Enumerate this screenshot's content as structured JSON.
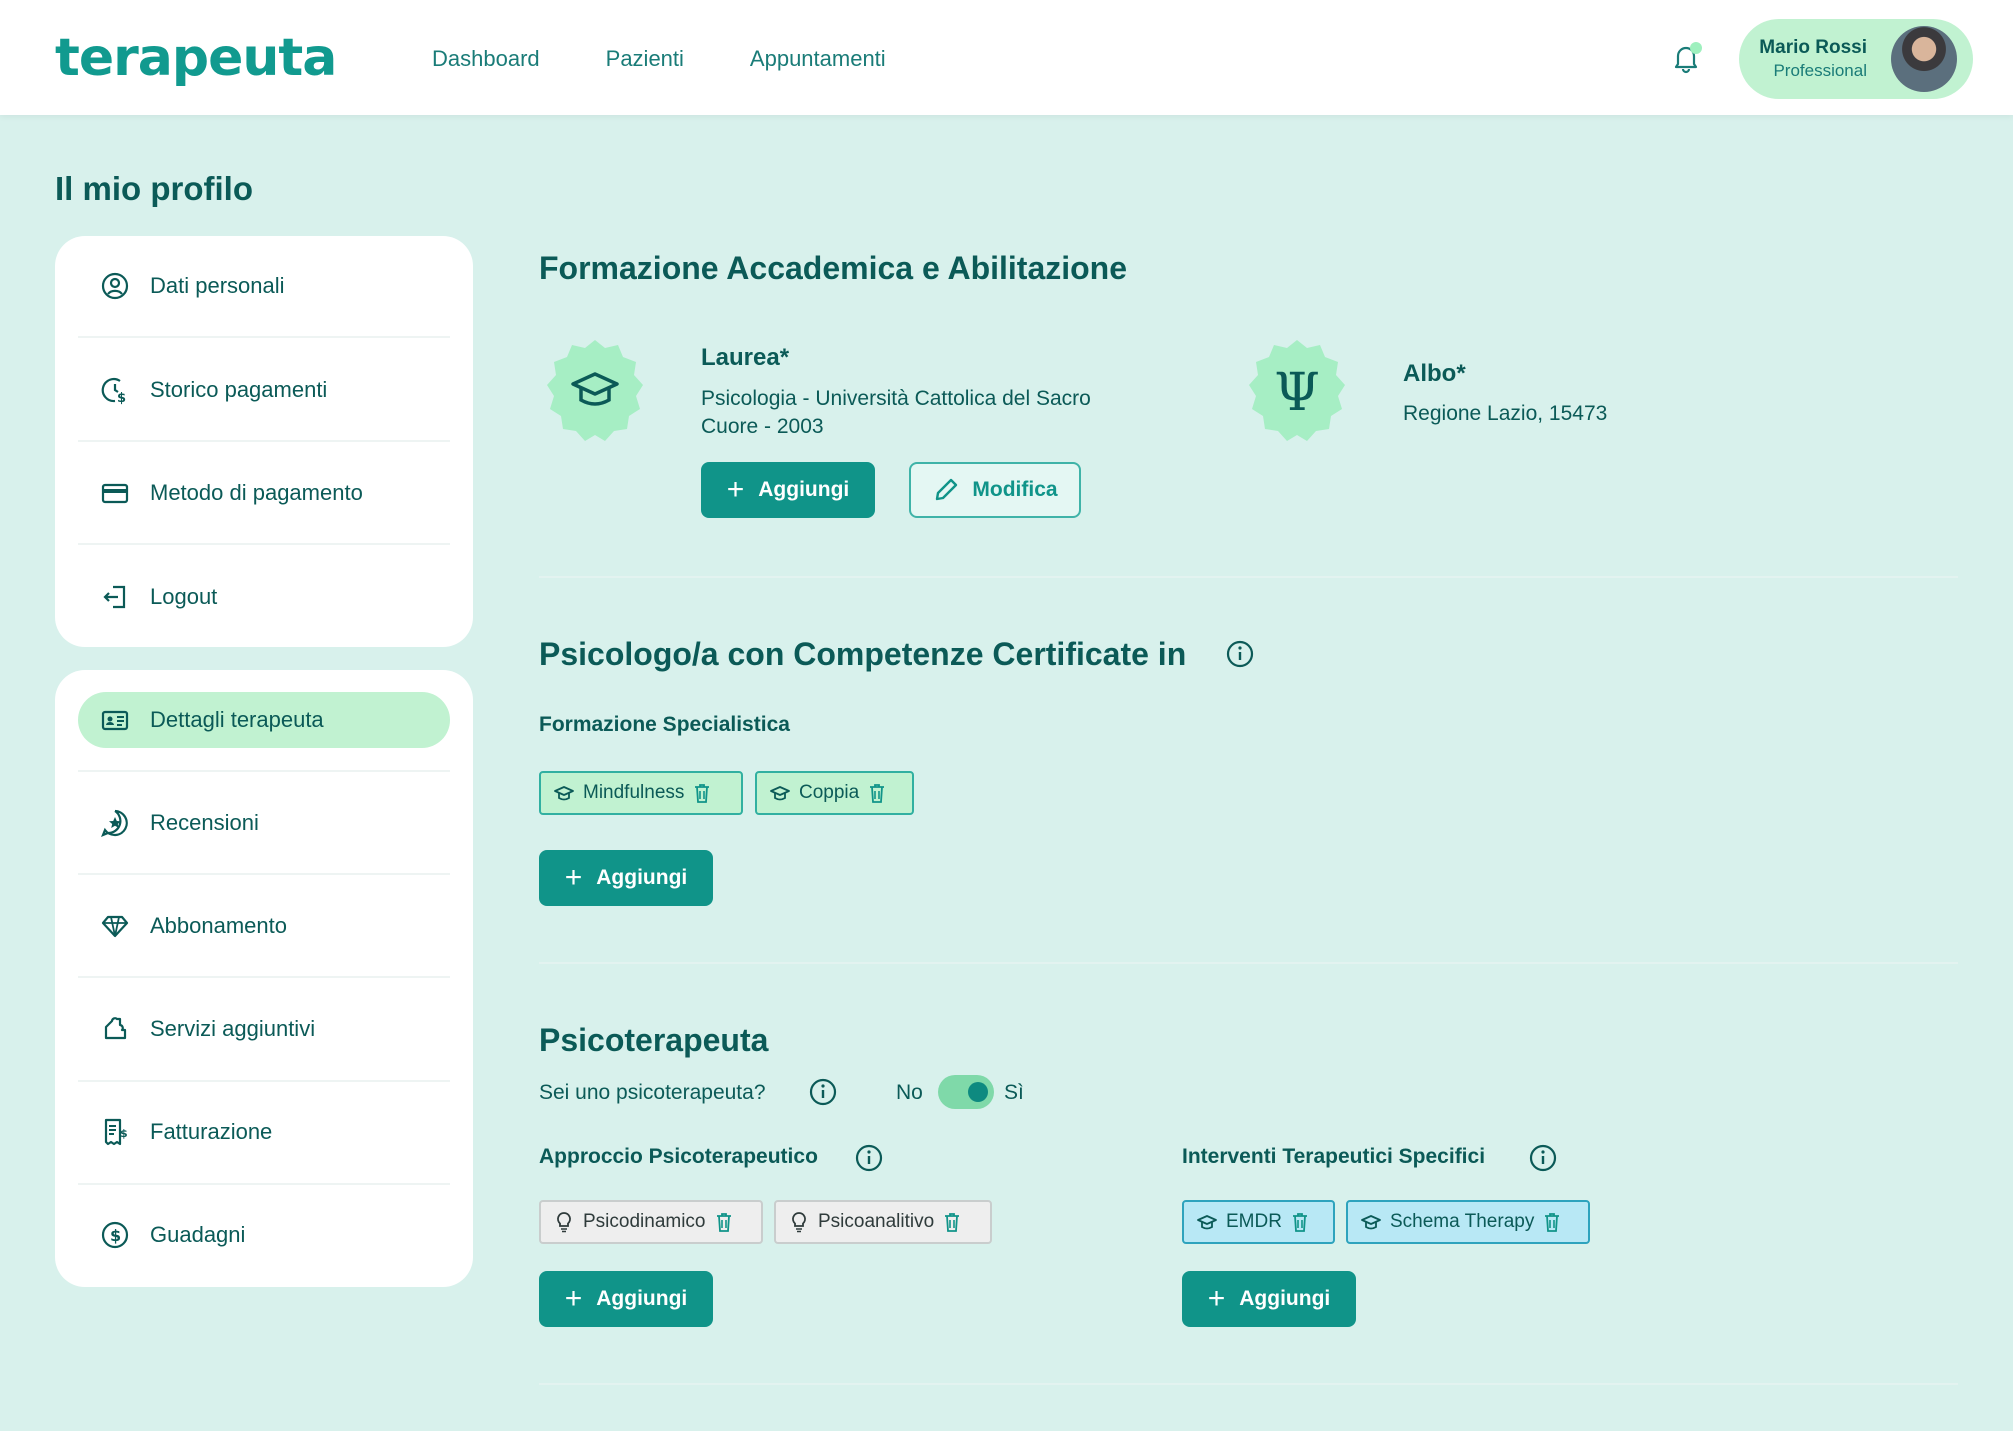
{
  "header": {
    "logo": "terapeuta",
    "nav": [
      "Dashboard",
      "Pazienti",
      "Appuntamenti"
    ],
    "user": {
      "name": "Mario Rossi",
      "role": "Professional"
    }
  },
  "page": {
    "title": "Il mio profilo"
  },
  "sidebar": {
    "group1": [
      {
        "label": "Dati personali",
        "icon": "user-circle-icon"
      },
      {
        "label": "Storico pagamenti",
        "icon": "clock-dollar-icon"
      },
      {
        "label": "Metodo di pagamento",
        "icon": "credit-card-icon"
      },
      {
        "label": "Logout",
        "icon": "logout-icon"
      }
    ],
    "group2": [
      {
        "label": "Dettagli terapeuta",
        "icon": "id-card-icon",
        "active": true
      },
      {
        "label": "Recensioni",
        "icon": "star-badge-icon"
      },
      {
        "label": "Abbonamento",
        "icon": "diamond-icon"
      },
      {
        "label": "Servizi aggiuntivi",
        "icon": "puzzle-icon"
      },
      {
        "label": "Fatturazione",
        "icon": "receipt-icon"
      },
      {
        "label": "Guadagni",
        "icon": "coin-icon"
      }
    ]
  },
  "formazione": {
    "title": "Formazione Accademica e Abilitazione",
    "laurea": {
      "label": "Laurea*",
      "line1": "Psicologia - Università Cattolica del Sacro",
      "line2": "Cuore - 2003"
    },
    "albo": {
      "label": "Albo*",
      "value": "Regione Lazio, 15473"
    },
    "add_label": "Aggiungi",
    "edit_label": "Modifica"
  },
  "competenze": {
    "title": "Psicologo/a con Competenze Certificate in",
    "subtitle": "Formazione Specialistica",
    "chips": [
      "Mindfulness",
      "Coppia"
    ],
    "add_label": "Aggiungi"
  },
  "psicoterapeuta": {
    "title": "Psicoterapeuta",
    "question": "Sei uno psicoterapeuta?",
    "no": "No",
    "si": "Sì",
    "toggle_on": true,
    "approccio": {
      "title": "Approccio Psicoterapeutico",
      "chips": [
        "Psicodinamico",
        "Psicoanalitivo"
      ],
      "add_label": "Aggiungi"
    },
    "interventi": {
      "title": "Interventi Terapeutici Specifici",
      "chips": [
        "EMDR",
        "Schema Therapy"
      ],
      "add_label": "Aggiungi"
    }
  }
}
